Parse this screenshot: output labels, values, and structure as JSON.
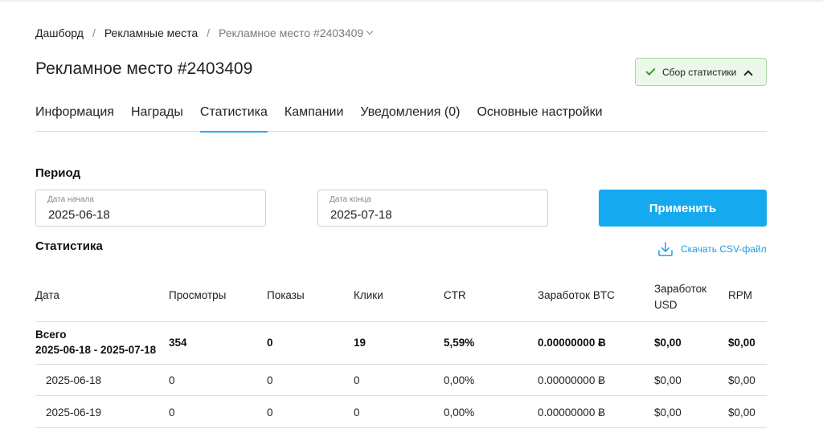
{
  "breadcrumb": {
    "items": [
      "Дашборд",
      "Рекламные места"
    ],
    "current": "Рекламное место #2403409",
    "separator": "/"
  },
  "page_title": "Рекламное место #2403409",
  "stats_badge": {
    "label": "Сбор статистики",
    "color": "#2e9d33",
    "icon": "check-icon"
  },
  "tabs": [
    {
      "label": "Информация",
      "active": false
    },
    {
      "label": "Награды",
      "active": false
    },
    {
      "label": "Статистика",
      "active": true
    },
    {
      "label": "Кампании",
      "active": false
    },
    {
      "label": "Уведомления (0)",
      "active": false
    },
    {
      "label": "Основные настройки",
      "active": false
    }
  ],
  "period": {
    "title": "Период",
    "start": {
      "label": "Дата начала",
      "value": "2025-06-18"
    },
    "end": {
      "label": "Дата конца",
      "value": "2025-07-18"
    },
    "apply_label": "Применить"
  },
  "stats": {
    "title": "Статистика",
    "csv_label": "Скачать CSV-файл",
    "columns": [
      "Дата",
      "Просмотры",
      "Показы",
      "Клики",
      "CTR",
      "Заработок BTC",
      "Заработок USD",
      "RPM"
    ],
    "total": {
      "label": "Всего",
      "range": "2025-06-18 - 2025-07-18",
      "values": [
        "354",
        "0",
        "19",
        "5,59%",
        "0.00000000 Ƀ",
        "$0,00",
        "$0,00"
      ]
    },
    "rows": [
      [
        "2025-06-18",
        "0",
        "0",
        "0",
        "0,00%",
        "0.00000000 Ƀ",
        "$0,00",
        "$0,00"
      ],
      [
        "2025-06-19",
        "0",
        "0",
        "0",
        "0,00%",
        "0.00000000 Ƀ",
        "$0,00",
        "$0,00"
      ]
    ]
  },
  "colors": {
    "accent": "#15aaf0",
    "tab_underline": "#29aaf0",
    "badge_bg": "#ecf8ea",
    "link": "#1a9ee6"
  }
}
